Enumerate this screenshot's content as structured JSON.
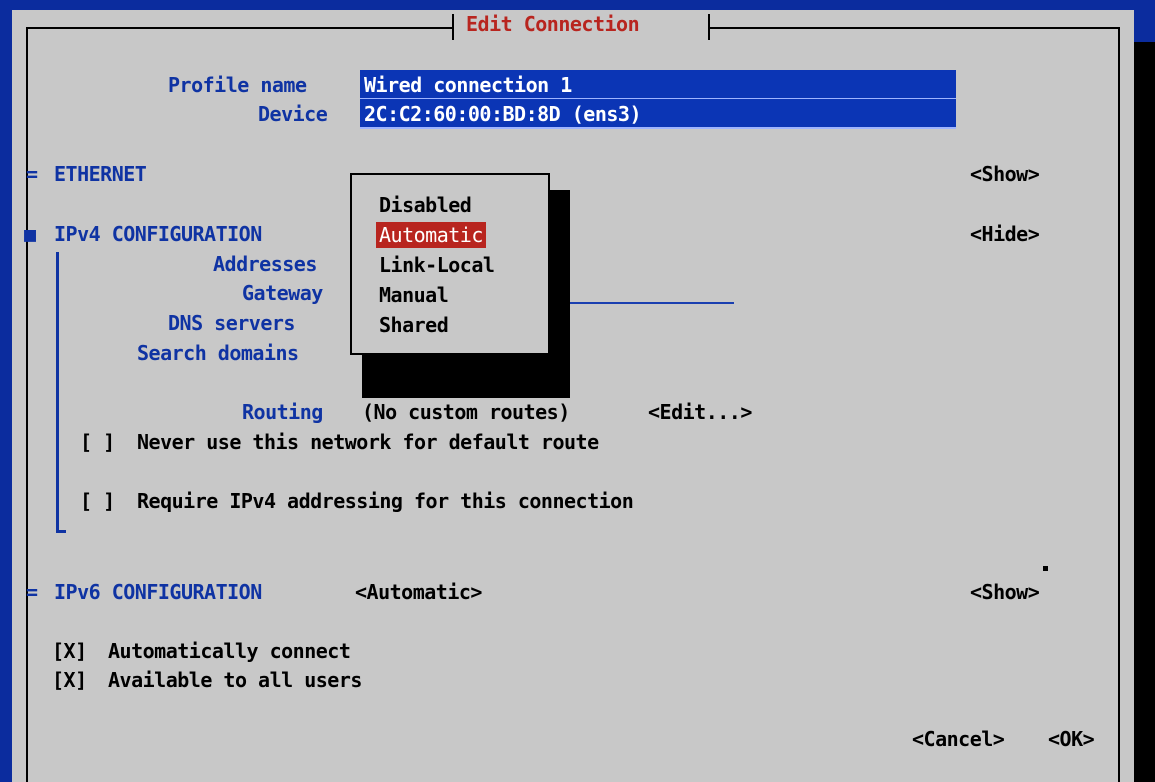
{
  "dialog": {
    "title": "Edit Connection"
  },
  "profile": {
    "label": "Profile name",
    "value": "Wired connection 1"
  },
  "device": {
    "label": "Device",
    "value": "2C:C2:60:00:BD:8D (ens3)"
  },
  "ethernet": {
    "marker": "=",
    "label": "ETHERNET",
    "toggle": "<Show>"
  },
  "ipv4": {
    "marker": "■",
    "label": "IPv4 CONFIGURATION",
    "toggle": "<Hide>",
    "addresses_label": "Addresses",
    "gateway_label": "Gateway",
    "dns_label": "DNS servers",
    "search_label": "Search domains",
    "routing_label": "Routing",
    "routing_value": "(No custom routes)",
    "routing_edit": "<Edit...>",
    "never_default": {
      "box": "[ ]",
      "label": "Never use this network for default route"
    },
    "require_ipv4": {
      "box": "[ ]",
      "label": "Require IPv4 addressing for this connection"
    }
  },
  "method_popup": {
    "options": [
      "Disabled",
      "Automatic",
      "Link-Local",
      "Manual",
      "Shared"
    ],
    "selected": "Automatic"
  },
  "ipv6": {
    "marker": "=",
    "label": "IPv6 CONFIGURATION",
    "method": "<Automatic>",
    "toggle": "<Show>"
  },
  "auto_connect": {
    "box": "[X]",
    "label": "Automatically connect"
  },
  "all_users": {
    "box": "[X]",
    "label": "Available to all users"
  },
  "buttons": {
    "cancel": "<Cancel>",
    "ok": "<OK>"
  },
  "colors": {
    "background": "#0b2c9e",
    "dialog": "#c8c8c8",
    "label_blue": "#0f33a3",
    "field_blue": "#0b35b5",
    "selection_red": "#b8251f"
  }
}
